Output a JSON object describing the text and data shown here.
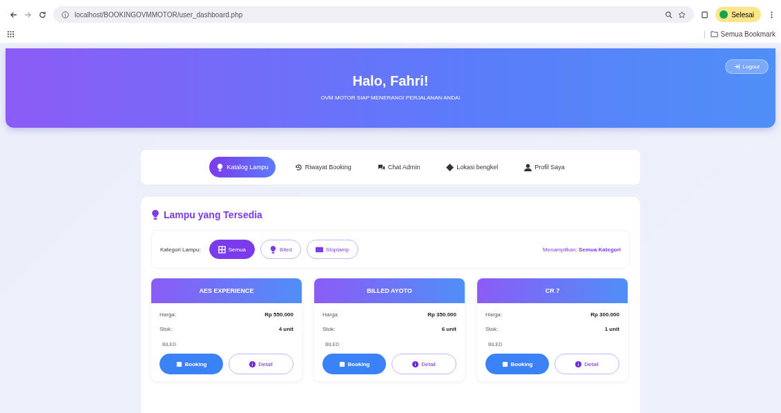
{
  "browser": {
    "url": "localhost/BOOKINGOVMMOTOR/user_dashboard.php",
    "profile_button": "Selesai",
    "bookmarks": "Semua Bookmark"
  },
  "header": {
    "logout": "Logout",
    "title": "Halo, Fahri!",
    "subtitle": "OVM MOTOR SIAP MENERANGI PERJALANAN ANDA!"
  },
  "tabs": [
    {
      "label": "Katalog Lampu",
      "kind": "bulb",
      "selected": true
    },
    {
      "label": "Riwayat Booking",
      "kind": "history",
      "selected": false
    },
    {
      "label": "Chat Admin",
      "kind": "chat",
      "selected": false
    },
    {
      "label": "Lokasi bengkel",
      "kind": "pin",
      "selected": false
    },
    {
      "label": "Profil Saya",
      "kind": "user",
      "selected": false
    }
  ],
  "section_title": "Lampu yang Tersedia",
  "filter": {
    "label": "Kategori Lampu:",
    "status_prefix": "Menampilkan:",
    "status_value": "Semua Kategori",
    "chips": [
      {
        "label": "Semua",
        "kind": "grid",
        "selected": true
      },
      {
        "label": "Biled",
        "kind": "bulb",
        "selected": false
      },
      {
        "label": "Stoplamp",
        "kind": "card",
        "selected": false
      }
    ]
  },
  "products": [
    {
      "name": "AES EXPERIENCE",
      "price_label": "Harga:",
      "price": "Rp 550.000",
      "stock_label": "Stok:",
      "stock": "4 unit",
      "category": "BILED",
      "book": "Booking",
      "detail": "Detail"
    },
    {
      "name": "BILLED AYOTO",
      "price_label": "Harga:",
      "price": "Rp 350.000",
      "stock_label": "Stok:",
      "stock": "6 unit",
      "category": "BILED",
      "book": "Booking",
      "detail": "Detail"
    },
    {
      "name": "CR 7",
      "price_label": "Harga:",
      "price": "Rp 300.000",
      "stock_label": "Stok:",
      "stock": "1 unit",
      "category": "BILED",
      "book": "Booking",
      "detail": "Detail"
    }
  ]
}
